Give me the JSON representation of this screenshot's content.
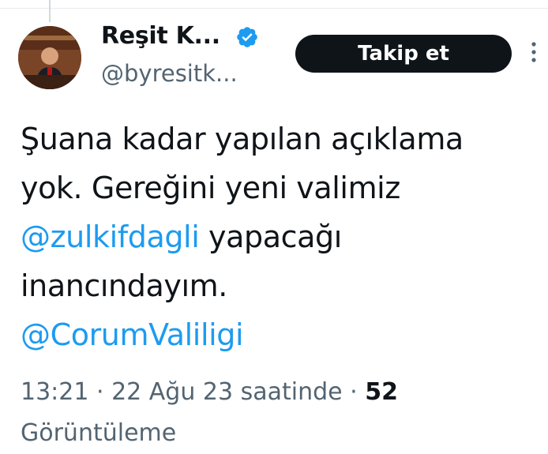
{
  "author": {
    "name": "Reşit K...",
    "handle": "@byresitk...",
    "verified": true,
    "avatar_icon": "profile-photo"
  },
  "follow_button": {
    "label": "Takip et"
  },
  "more_icon": "more-vertical-icon",
  "tweet": {
    "text_part1": "Şuana kadar yapılan açıklama yok. Gereğini yeni valimiz ",
    "mention1": "@zulkifdagli",
    "text_part2": " yapacağı inancındayım.",
    "mention2": "@CorumValiligi"
  },
  "meta": {
    "time": "13:21",
    "separator": " · ",
    "date": "22 Ağu 23 saatinde",
    "views_count": "52",
    "views_label": "Görüntüleme"
  },
  "colors": {
    "accent": "#1d9bf0",
    "text": "#0f1419",
    "secondary": "#536471",
    "button_bg": "#0f1419"
  }
}
